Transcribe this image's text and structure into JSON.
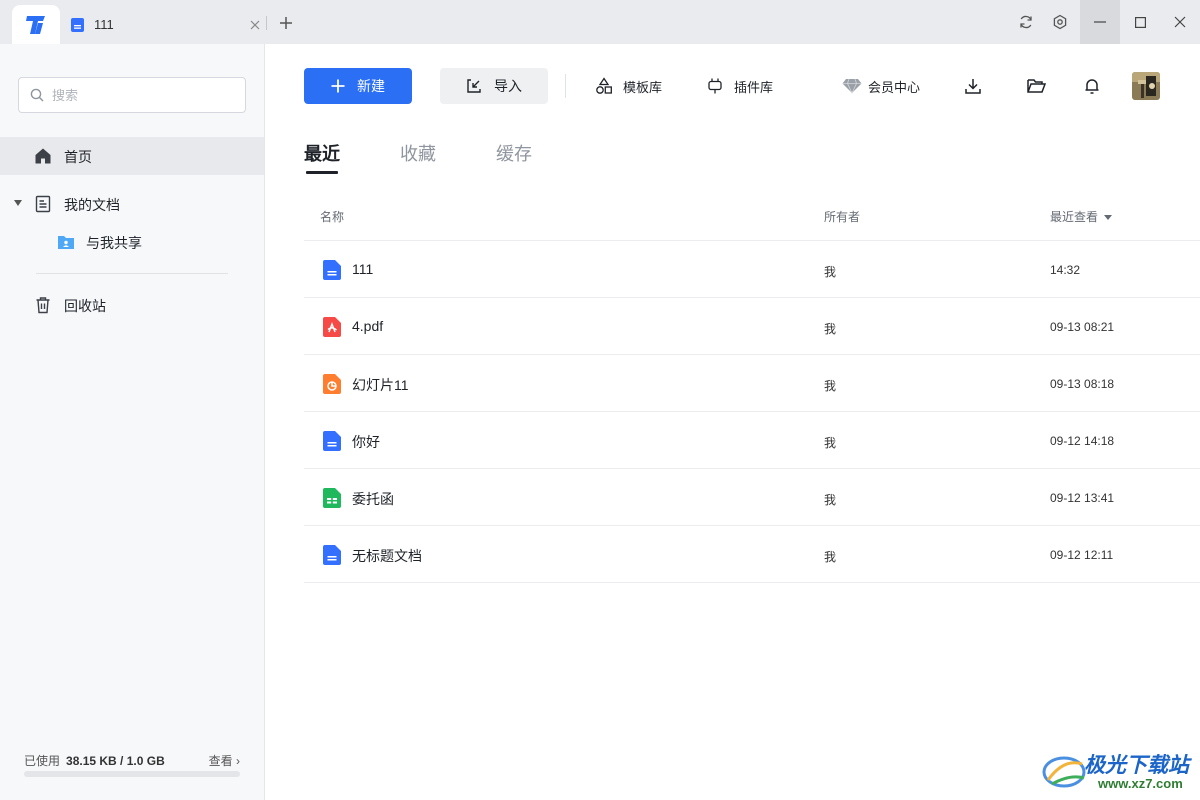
{
  "titlebar": {
    "tab_title": "111"
  },
  "sidebar": {
    "search_placeholder": "搜索",
    "items": [
      {
        "label": "首页"
      },
      {
        "label": "我的文档"
      },
      {
        "label": "与我共享"
      },
      {
        "label": "回收站"
      }
    ],
    "storage": {
      "used_label": "已使用",
      "used_value": "38.15 KB / 1.0 GB",
      "view_label": "查看 ›",
      "used_fraction": 0.0
    }
  },
  "toolbar": {
    "new_label": "新建",
    "import_label": "导入",
    "templates_label": "模板库",
    "plugins_label": "插件库",
    "member_label": "会员中心"
  },
  "tabs": [
    {
      "label": "最近",
      "active": true
    },
    {
      "label": "收藏",
      "active": false
    },
    {
      "label": "缓存",
      "active": false
    }
  ],
  "table": {
    "headers": {
      "name": "名称",
      "owner": "所有者",
      "last_viewed": "最近查看"
    },
    "rows": [
      {
        "name": "111",
        "type": "doc",
        "owner": "我",
        "time": "14:32"
      },
      {
        "name": "4.pdf",
        "type": "pdf",
        "owner": "我",
        "time": "09-13 08:21"
      },
      {
        "name": "幻灯片11",
        "type": "ppt",
        "owner": "我",
        "time": "09-13 08:18"
      },
      {
        "name": "你好",
        "type": "doc",
        "owner": "我",
        "time": "09-12 14:18"
      },
      {
        "name": "委托函",
        "type": "sheet",
        "owner": "我",
        "time": "09-12 13:41"
      },
      {
        "name": "无标题文档",
        "type": "doc",
        "owner": "我",
        "time": "09-12 12:11"
      }
    ]
  },
  "watermark": {
    "title": "极光下载站",
    "url": "www.xz7.com"
  },
  "colors": {
    "accent": "#2b6ff5",
    "doc": "#3370ff",
    "pdf": "#f54a45",
    "ppt": "#ff7d2e",
    "sheet": "#1fb85c"
  }
}
